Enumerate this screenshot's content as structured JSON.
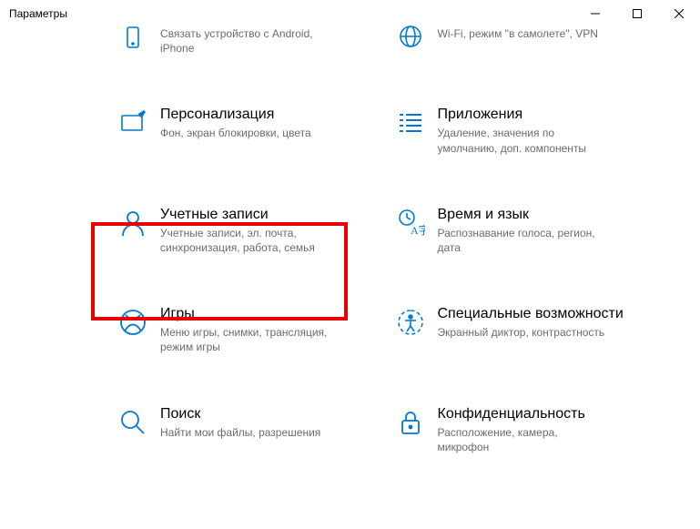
{
  "window": {
    "title": "Параметры"
  },
  "tiles": {
    "phone": {
      "title": "",
      "desc": "Связать устройство с Android, iPhone"
    },
    "network": {
      "title": "",
      "desc": "Wi-Fi, режим \"в самолете\", VPN"
    },
    "personalization": {
      "title": "Персонализация",
      "desc": "Фон, экран блокировки, цвета"
    },
    "apps": {
      "title": "Приложения",
      "desc": "Удаление, значения по умолчанию, доп. компоненты"
    },
    "accounts": {
      "title": "Учетные записи",
      "desc": "Учетные записи, эл. почта, синхронизация, работа, семья"
    },
    "time": {
      "title": "Время и язык",
      "desc": "Распознавание голоса, регион, дата"
    },
    "gaming": {
      "title": "Игры",
      "desc": "Меню игры, снимки, трансляция, режим игры"
    },
    "ease": {
      "title": "Специальные возможности",
      "desc": "Экранный диктор, контрастность"
    },
    "search": {
      "title": "Поиск",
      "desc": "Найти мои файлы, разрешения"
    },
    "privacy": {
      "title": "Конфиденциальность",
      "desc": "Расположение, камера, микрофон"
    }
  }
}
